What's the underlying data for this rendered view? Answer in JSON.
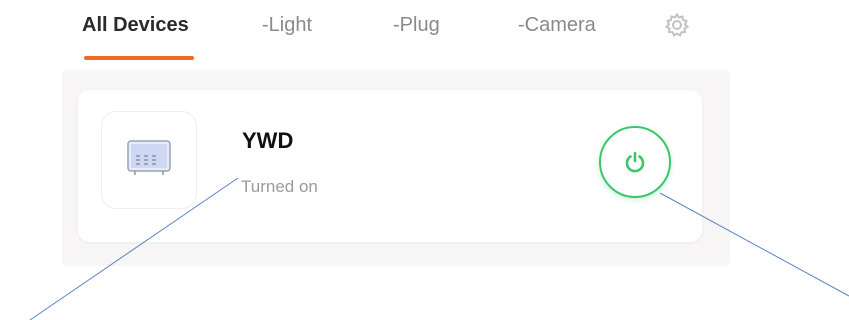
{
  "tabs": [
    {
      "label": "All Devices",
      "active": true
    },
    {
      "label": "-Light",
      "active": false
    },
    {
      "label": "-Plug",
      "active": false
    },
    {
      "label": "-Camera",
      "active": false
    }
  ],
  "settings_icon": "gear-icon",
  "device": {
    "name": "YWD",
    "status": "Turned on",
    "thumbnail_icon": "appliance-icon",
    "power_icon": "power-icon",
    "power_on": true
  },
  "colors": {
    "tab_indicator": "#f26b23",
    "power_green": "#3cc66a",
    "callout_line": "#5b86c5"
  }
}
